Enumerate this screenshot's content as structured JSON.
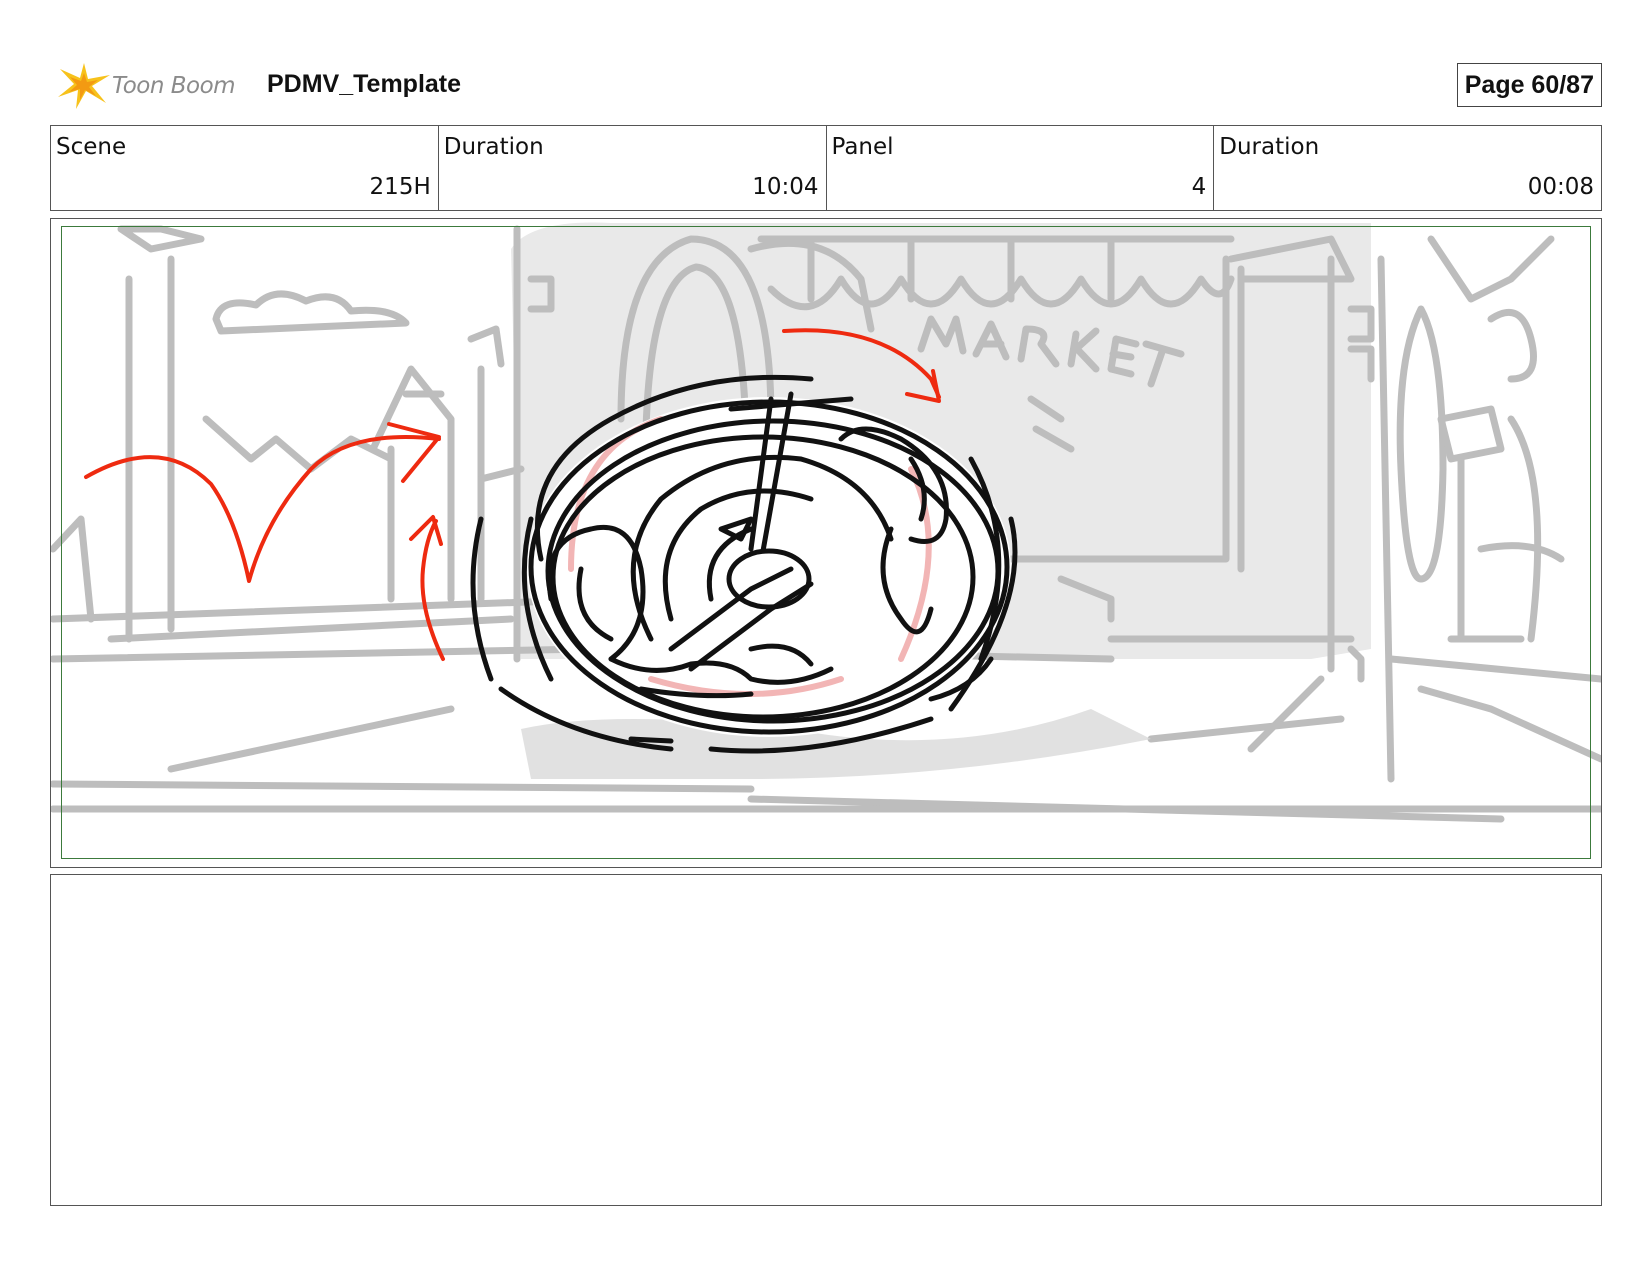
{
  "header": {
    "logo_text": "Toon Boom",
    "title": "PDMV_Template",
    "page": "Page 60/87"
  },
  "info": [
    {
      "label": "Scene",
      "value": "215H"
    },
    {
      "label": "Duration",
      "value": "10:04"
    },
    {
      "label": "Panel",
      "value": "4"
    },
    {
      "label": "Duration",
      "value": "00:08"
    }
  ],
  "panel": {
    "sign_text": "MARKET",
    "colors": {
      "background_sketch": "#bdbdbd",
      "wall_fill": "#e8e8e8",
      "character_ink": "#111111",
      "motion_arrows": "#ee2a10",
      "character_tone": "#f2b5b5",
      "safe_frame": "#3c7a3c"
    }
  },
  "notes": {
    "text": ""
  }
}
